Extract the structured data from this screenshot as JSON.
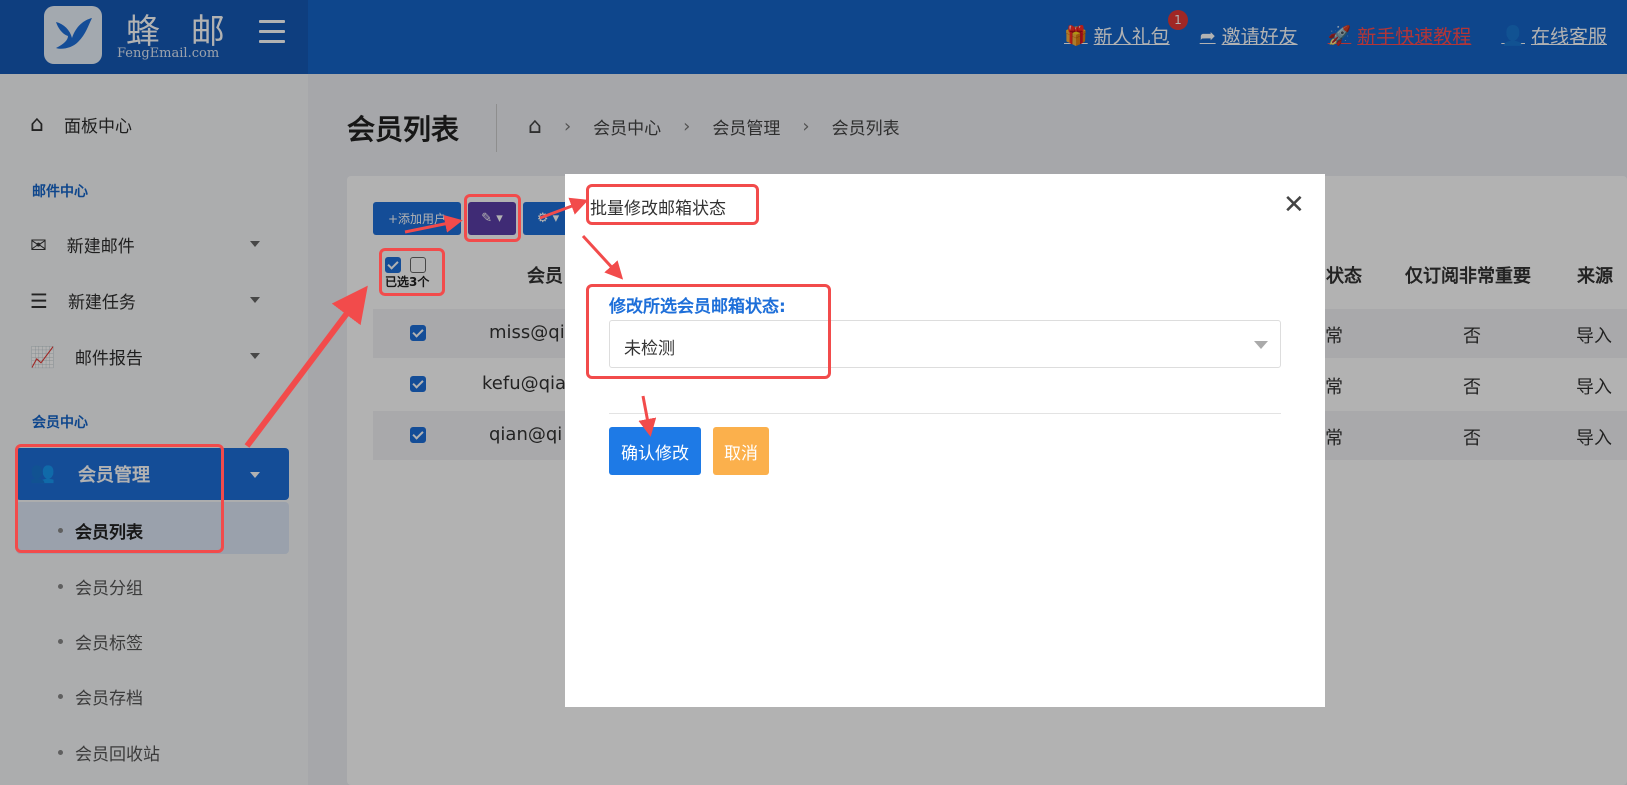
{
  "brand": {
    "name_cn": "蜂 邮",
    "name_en": "FengEmail.com"
  },
  "topnav": {
    "gift": "新人礼包",
    "gift_badge": "1",
    "invite": "邀请好友",
    "tutorial": "新手快速教程",
    "support": "在线客服"
  },
  "sidebar": {
    "dashboard": "面板中心",
    "section_mail": "邮件中心",
    "new_mail": "新建邮件",
    "new_task": "新建任务",
    "mail_report": "邮件报告",
    "section_member": "会员中心",
    "member_manage": "会员管理",
    "sub": [
      "会员列表",
      "会员分组",
      "会员标签",
      "会员存档",
      "会员回收站"
    ]
  },
  "page": {
    "title": "会员列表",
    "breadcrumb": [
      "会员中心",
      "会员管理",
      "会员列表"
    ]
  },
  "toolbar": {
    "add_user": "+添加用户",
    "selected": "已选3个"
  },
  "table": {
    "headers": [
      "会员",
      "状态",
      "仅订阅非常重要",
      "来源"
    ],
    "rows": [
      {
        "email": "miss@qi",
        "status": "常",
        "important": "否",
        "source": "导入"
      },
      {
        "email": "kefu@qia",
        "status": "常",
        "important": "否",
        "source": "导入"
      },
      {
        "email": "qian@qi",
        "status": "常",
        "important": "否",
        "source": "导入"
      }
    ]
  },
  "modal": {
    "title": "批量修改邮箱状态",
    "label": "修改所选会员邮箱状态:",
    "selected_value": "未检测",
    "confirm": "确认修改",
    "cancel": "取消"
  },
  "colors": {
    "primary": "#1e6fd9",
    "annotation": "#f24b4b",
    "cancel": "#fbb04c"
  }
}
